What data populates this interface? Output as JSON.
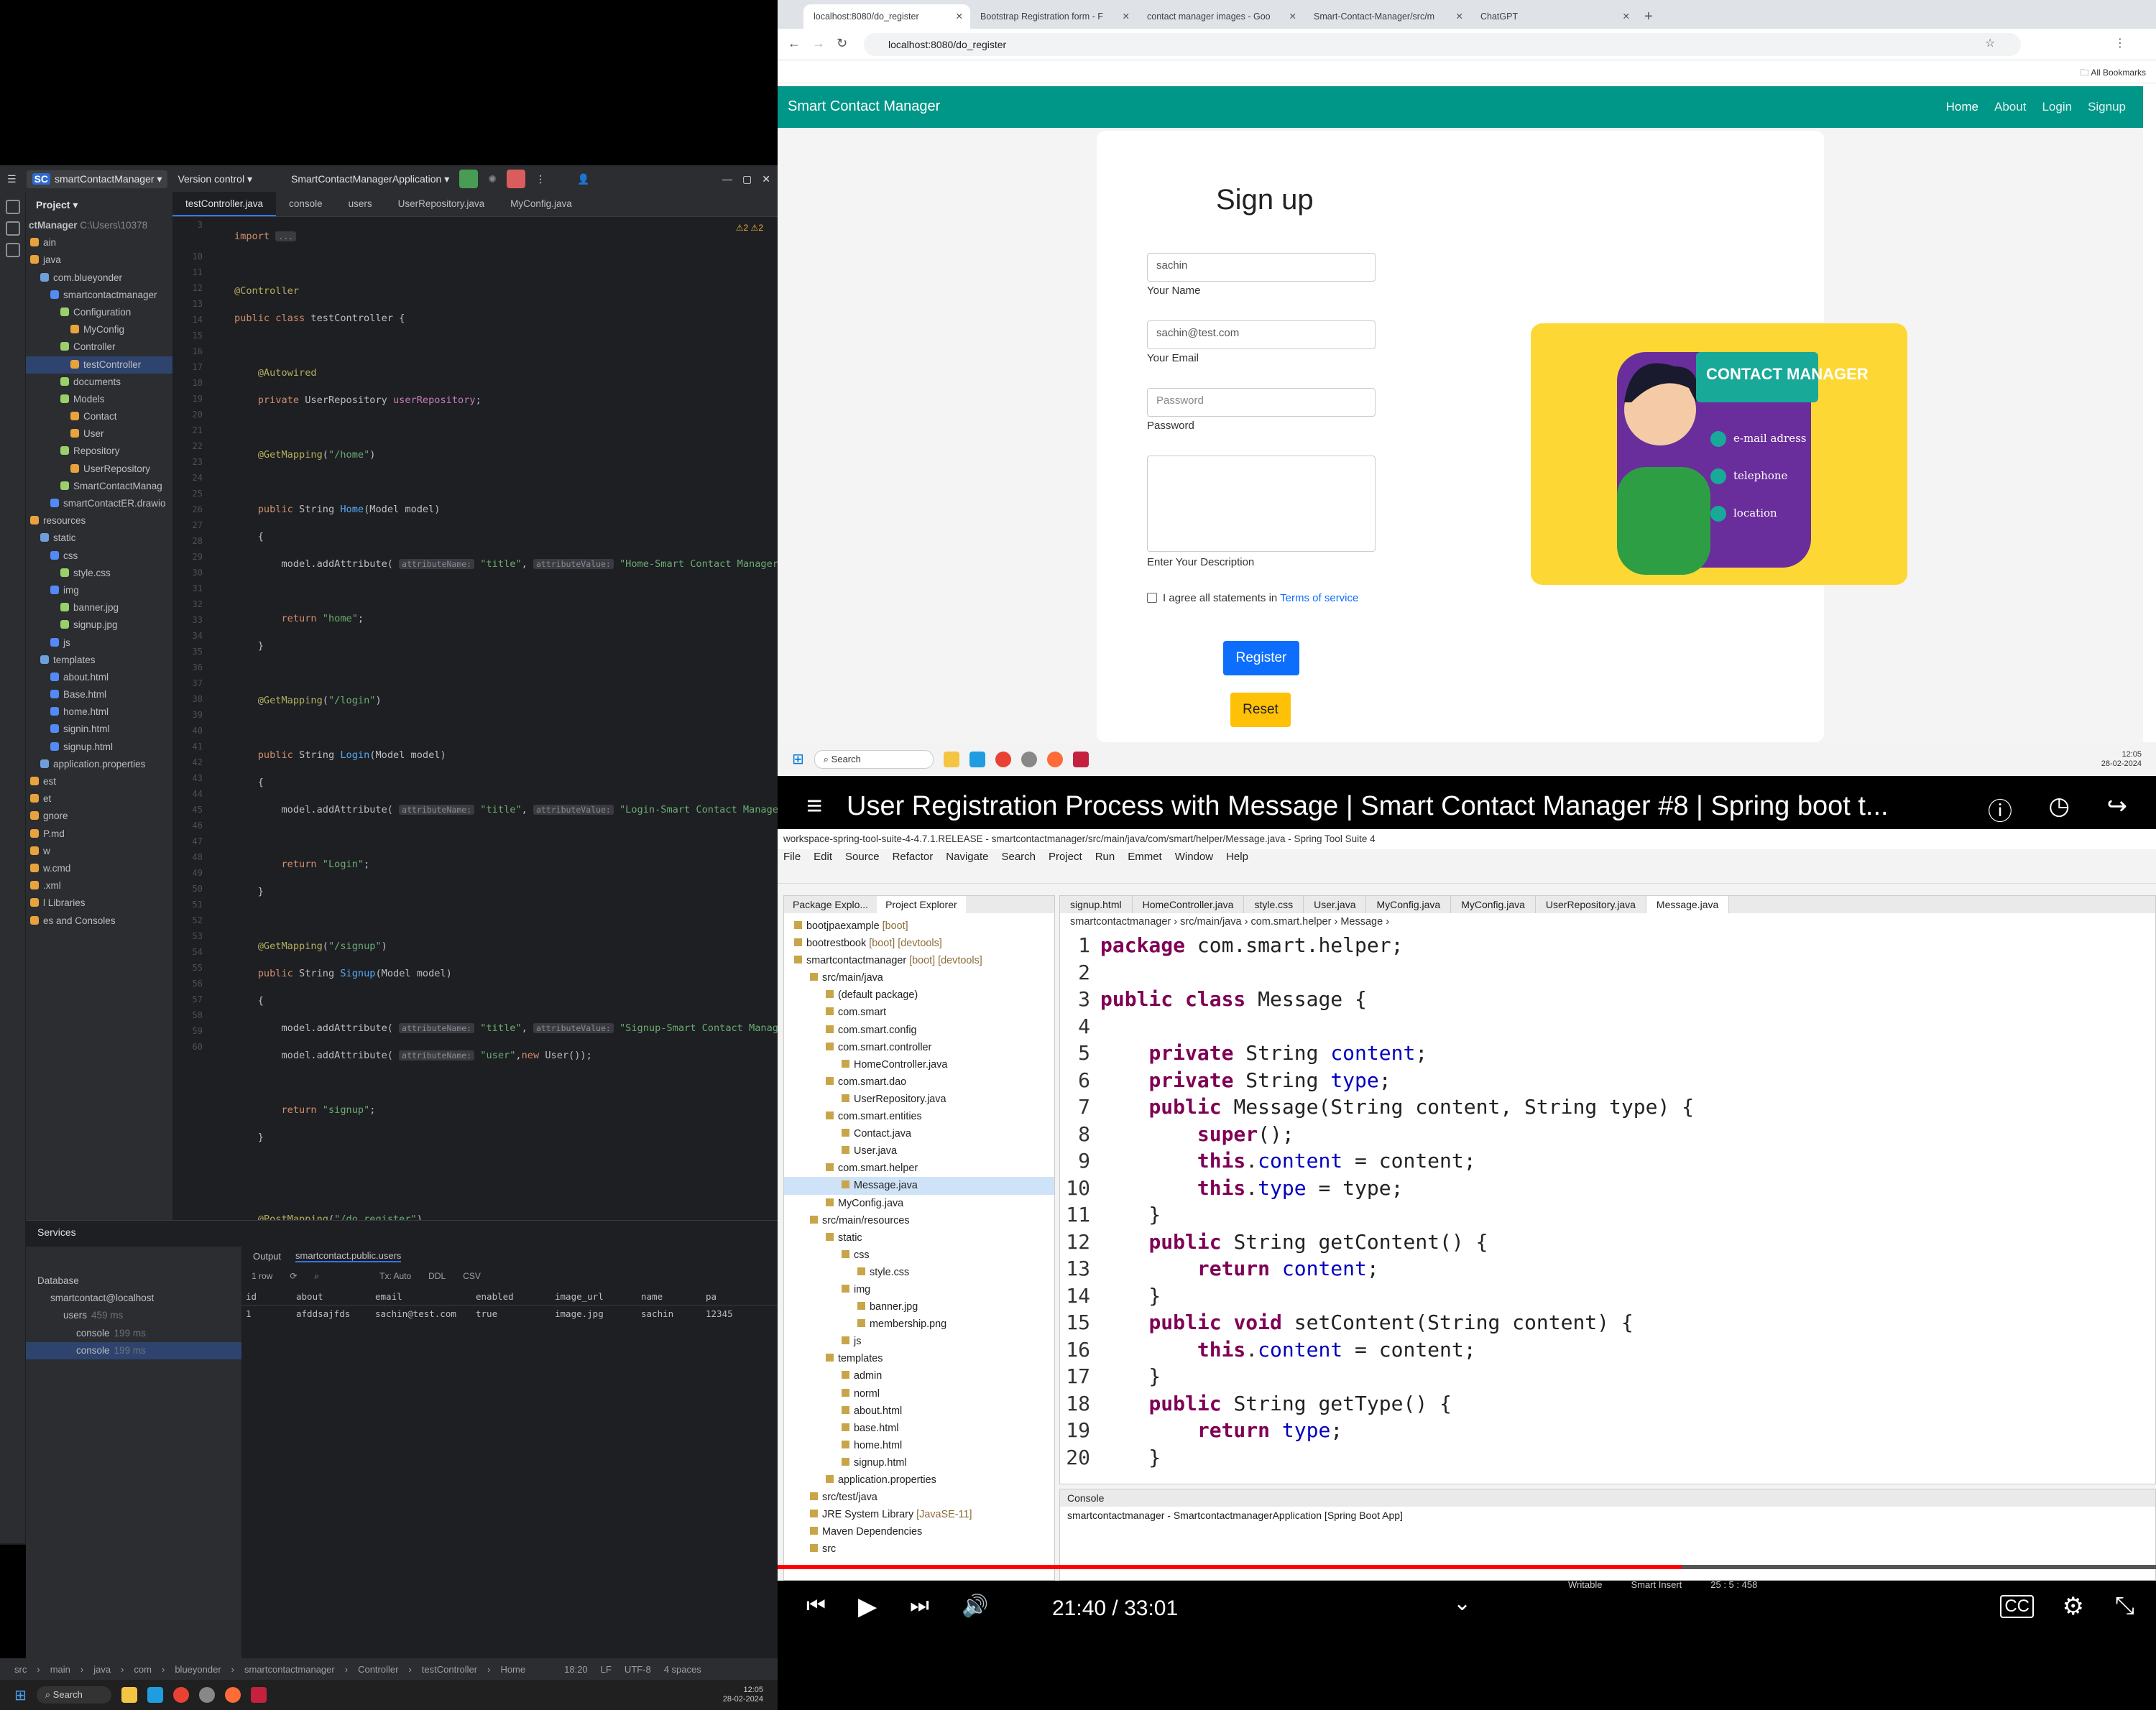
{
  "intellij": {
    "project_name": "smartContactManager",
    "vcs": "Version control",
    "run_config": "SmartContactManagerApplication",
    "project_label": "Project",
    "project_root": "ctManager",
    "project_root_path": "C:\\Users\\10378",
    "tabs": [
      "testController.java",
      "console",
      "users",
      "UserRepository.java",
      "MyConfig.java"
    ],
    "tree": [
      {
        "label": "ain",
        "depth": 0
      },
      {
        "label": "java",
        "depth": 0
      },
      {
        "label": "com.blueyonder",
        "depth": 1
      },
      {
        "label": "smartcontactmanager",
        "depth": 2
      },
      {
        "label": "Configuration",
        "depth": 3
      },
      {
        "label": "MyConfig",
        "depth": 4
      },
      {
        "label": "Controller",
        "depth": 3
      },
      {
        "label": "testController",
        "depth": 4,
        "sel": true
      },
      {
        "label": "documents",
        "depth": 3
      },
      {
        "label": "Models",
        "depth": 3
      },
      {
        "label": "Contact",
        "depth": 4
      },
      {
        "label": "User",
        "depth": 4
      },
      {
        "label": "Repository",
        "depth": 3
      },
      {
        "label": "UserRepository",
        "depth": 4
      },
      {
        "label": "SmartContactManag",
        "depth": 3
      },
      {
        "label": "smartContactER.drawio",
        "depth": 2
      },
      {
        "label": "resources",
        "depth": 0
      },
      {
        "label": "static",
        "depth": 1
      },
      {
        "label": "css",
        "depth": 2
      },
      {
        "label": "style.css",
        "depth": 3
      },
      {
        "label": "img",
        "depth": 2
      },
      {
        "label": "banner.jpg",
        "depth": 3
      },
      {
        "label": "signup.jpg",
        "depth": 3
      },
      {
        "label": "js",
        "depth": 2
      },
      {
        "label": "templates",
        "depth": 1
      },
      {
        "label": "about.html",
        "depth": 2
      },
      {
        "label": "Base.html",
        "depth": 2
      },
      {
        "label": "home.html",
        "depth": 2
      },
      {
        "label": "signin.html",
        "depth": 2
      },
      {
        "label": "signup.html",
        "depth": 2
      },
      {
        "label": "application.properties",
        "depth": 1
      },
      {
        "label": "est",
        "depth": 0
      },
      {
        "label": "et",
        "depth": 0
      },
      {
        "label": "gnore",
        "depth": 0
      },
      {
        "label": "P.md",
        "depth": 0
      },
      {
        "label": "w",
        "depth": 0
      },
      {
        "label": "w.cmd",
        "depth": 0
      },
      {
        "label": ".xml",
        "depth": 0
      },
      {
        "label": "l Libraries",
        "depth": 0
      },
      {
        "label": "es and Consoles",
        "depth": 0
      }
    ],
    "gutter": [
      "3",
      "",
      "10",
      "11",
      "12",
      "13",
      "14",
      "15",
      "16",
      "17",
      "18",
      "19",
      "20",
      "21",
      "22",
      "23",
      "24",
      "25",
      "26",
      "27",
      "28",
      "29",
      "30",
      "31",
      "32",
      "33",
      "34",
      "35",
      "36",
      "37",
      "38",
      "39",
      "40",
      "41",
      "42",
      "43",
      "44",
      "45",
      "46",
      "47",
      "48",
      "49",
      "50",
      "51",
      "52",
      "53",
      "54",
      "55",
      "56",
      "57",
      "58",
      "59",
      "60"
    ],
    "warnings": "2",
    "warnings2": "2",
    "services_label": "Services",
    "db_tree": [
      "Database",
      "smartcontact@localhost",
      "users",
      "console",
      "console"
    ],
    "db_times": [
      "",
      "",
      "459 ms",
      "199 ms",
      "199 ms"
    ],
    "output_tab": "Output",
    "table_tab": "smartcontact.public.users",
    "tx_label": "Tx: Auto",
    "ddl_label": "DDL",
    "csv_label": "CSV",
    "rows_label": "1 row",
    "columns": [
      "id",
      "about",
      "email",
      "enabled",
      "image_url",
      "name",
      "pa"
    ],
    "row": [
      "1",
      "afddsajfds",
      "sachin@test.com",
      "true",
      "image.jpg",
      "sachin",
      "12345"
    ],
    "status_path": [
      "src",
      "main",
      "java",
      "com",
      "blueyonder",
      "smartcontactmanager",
      "Controller",
      "testController",
      "Home"
    ],
    "status_right": [
      "18:20",
      "LF",
      "UTF-8",
      "4 spaces"
    ]
  },
  "taskbar": {
    "search": "Search",
    "time": "12:05",
    "date": "28-02-2024"
  },
  "chrome": {
    "tabs": [
      "localhost:8080/do_register",
      "Bootstrap Registration form - F",
      "contact manager images - Goo",
      "Smart-Contact-Manager/src/m",
      "ChatGPT"
    ],
    "url": "localhost:8080/do_register",
    "bookmarks": "All Bookmarks",
    "brand": "Smart Contact Manager",
    "nav": [
      "Home",
      "About",
      "Login",
      "Signup"
    ],
    "form": {
      "title": "Sign up",
      "name_value": "sachin",
      "name_label": "Your Name",
      "email_value": "sachin@test.com",
      "email_label": "Your Email",
      "password_placeholder": "Password",
      "password_label": "Password",
      "desc_label": "Enter Your Description",
      "agree": "I agree all statements in",
      "terms": "Terms of service",
      "register": "Register",
      "reset": "Reset"
    },
    "banner": {
      "title": "CONTACT MANAGER",
      "items": [
        "e-mail adress",
        "telephone",
        "location"
      ]
    }
  },
  "video": {
    "title": "User Registration Process with Message | Smart Contact Manager #8 | Spring boot t...",
    "time": "21:40 / 33:01",
    "progress": 0.656,
    "sts": {
      "window_title": "workspace-spring-tool-suite-4-4.7.1.RELEASE - smartcontactmanager/src/main/java/com/smart/helper/Message.java - Spring Tool Suite 4",
      "menu": [
        "File",
        "Edit",
        "Source",
        "Refactor",
        "Navigate",
        "Search",
        "Project",
        "Run",
        "Emmet",
        "Window",
        "Help"
      ],
      "explorer_tabs": [
        "Package Explo...",
        "Project Explorer"
      ],
      "editor_tabs": [
        "signup.html",
        "HomeController.java",
        "style.css",
        "User.java",
        "MyConfig.java",
        "MyConfig.java",
        "UserRepository.java",
        "Message.java"
      ],
      "breadcrumb": [
        "smartcontactmanager",
        "src/main/java",
        "com.smart.helper",
        "Message"
      ],
      "tree": [
        {
          "label": "bootjpaexample",
          "deco": "[boot]",
          "depth": 0
        },
        {
          "label": "bootrestbook",
          "deco": "[boot] [devtools]",
          "depth": 0
        },
        {
          "label": "smartcontactmanager",
          "deco": "[boot] [devtools]",
          "depth": 0
        },
        {
          "label": "src/main/java",
          "deco": "",
          "depth": 1
        },
        {
          "label": "(default package)",
          "deco": "",
          "depth": 2
        },
        {
          "label": "com.smart",
          "deco": "",
          "depth": 2
        },
        {
          "label": "com.smart.config",
          "deco": "",
          "depth": 2
        },
        {
          "label": "com.smart.controller",
          "deco": "",
          "depth": 2
        },
        {
          "label": "HomeController.java",
          "deco": "",
          "depth": 3
        },
        {
          "label": "com.smart.dao",
          "deco": "",
          "depth": 2
        },
        {
          "label": "UserRepository.java",
          "deco": "",
          "depth": 3
        },
        {
          "label": "com.smart.entities",
          "deco": "",
          "depth": 2
        },
        {
          "label": "Contact.java",
          "deco": "",
          "depth": 3
        },
        {
          "label": "User.java",
          "deco": "",
          "depth": 3
        },
        {
          "label": "com.smart.helper",
          "deco": "",
          "depth": 2
        },
        {
          "label": "Message.java",
          "deco": "",
          "depth": 3
        },
        {
          "label": "MyConfig.java",
          "deco": "",
          "depth": 2
        },
        {
          "label": "src/main/resources",
          "deco": "",
          "depth": 1
        },
        {
          "label": "static",
          "deco": "",
          "depth": 2
        },
        {
          "label": "css",
          "deco": "",
          "depth": 3
        },
        {
          "label": "style.css",
          "deco": "",
          "depth": 4
        },
        {
          "label": "img",
          "deco": "",
          "depth": 3
        },
        {
          "label": "banner.jpg",
          "deco": "",
          "depth": 4
        },
        {
          "label": "membership.png",
          "deco": "",
          "depth": 4
        },
        {
          "label": "js",
          "deco": "",
          "depth": 3
        },
        {
          "label": "templates",
          "deco": "",
          "depth": 2
        },
        {
          "label": "admin",
          "deco": "",
          "depth": 3
        },
        {
          "label": "norml",
          "deco": "",
          "depth": 3
        },
        {
          "label": "about.html",
          "deco": "",
          "depth": 3
        },
        {
          "label": "base.html",
          "deco": "",
          "depth": 3
        },
        {
          "label": "home.html",
          "deco": "",
          "depth": 3
        },
        {
          "label": "signup.html",
          "deco": "",
          "depth": 3
        },
        {
          "label": "application.properties",
          "deco": "",
          "depth": 2
        },
        {
          "label": "src/test/java",
          "deco": "",
          "depth": 1
        },
        {
          "label": "JRE System Library",
          "deco": "[JavaSE-11]",
          "depth": 1
        },
        {
          "label": "Maven Dependencies",
          "deco": "",
          "depth": 1
        },
        {
          "label": "src",
          "deco": "",
          "depth": 1
        }
      ],
      "console_tab": "Console",
      "console_line": "smartcontactmanager - SmartcontactmanagerApplication [Spring Boot App]",
      "status": [
        "Writable",
        "Smart Insert",
        "25 : 5 : 458"
      ]
    }
  }
}
